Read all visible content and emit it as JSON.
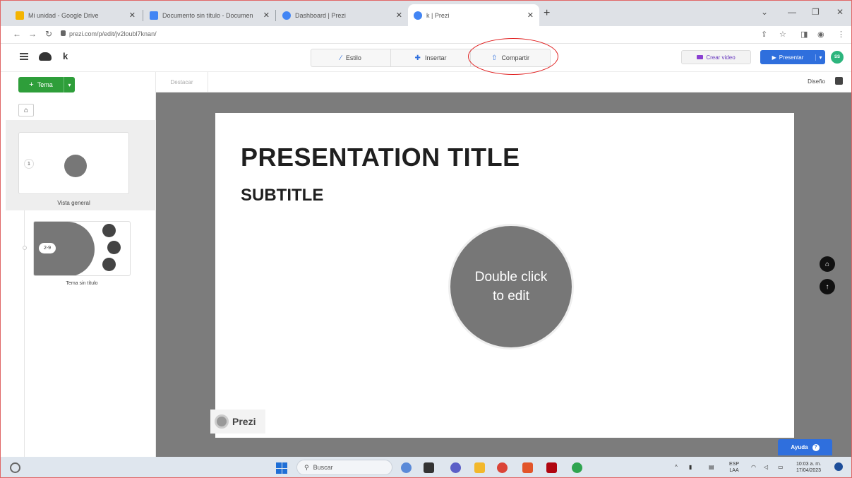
{
  "browser": {
    "tabs": [
      {
        "label": "Mi unidad - Google Drive",
        "favicon_color": "#f4b400",
        "active": false
      },
      {
        "label": "Documento sin título - Documen",
        "favicon_color": "#4285f4",
        "active": false
      },
      {
        "label": "Dashboard | Prezi",
        "favicon_color": "#4285f4",
        "active": false
      },
      {
        "label": "k | Prezi",
        "favicon_color": "#4285f4",
        "active": true
      }
    ],
    "new_tab": "+",
    "url": "prezi.com/p/edit/jv2loubl7knan/"
  },
  "app": {
    "project_name": "k",
    "toolbar": {
      "estilo": "Estilo",
      "insertar": "Insertar",
      "compartir": "Compartir"
    },
    "crear_video": "Crear video",
    "presentar": "Presentar",
    "avatar_initials": "SS"
  },
  "sidebar": {
    "tema_button": "Tema",
    "topics": [
      {
        "number": "1",
        "caption": "Vista general"
      },
      {
        "number": "2-9",
        "caption": "Tema sin título"
      }
    ]
  },
  "canvas": {
    "destacar": "Destacar",
    "diseno": "Diseño",
    "slide": {
      "title": "PRESENTATION TITLE",
      "subtitle": "SUBTITLE",
      "circle_line1": "Double click",
      "circle_line2": "to edit"
    },
    "brand": "Prezi",
    "ayuda": "Ayuda"
  },
  "taskbar": {
    "search_placeholder": "Buscar",
    "language": "ESP",
    "layout": "LAA",
    "time": "10:03 a. m.",
    "date": "17/04/2023"
  },
  "colors": {
    "accent_blue": "#2f6fdd",
    "tema_green": "#2e9e3a",
    "canvas_gray": "#7c7c7c",
    "highlight_red": "#e02020"
  }
}
